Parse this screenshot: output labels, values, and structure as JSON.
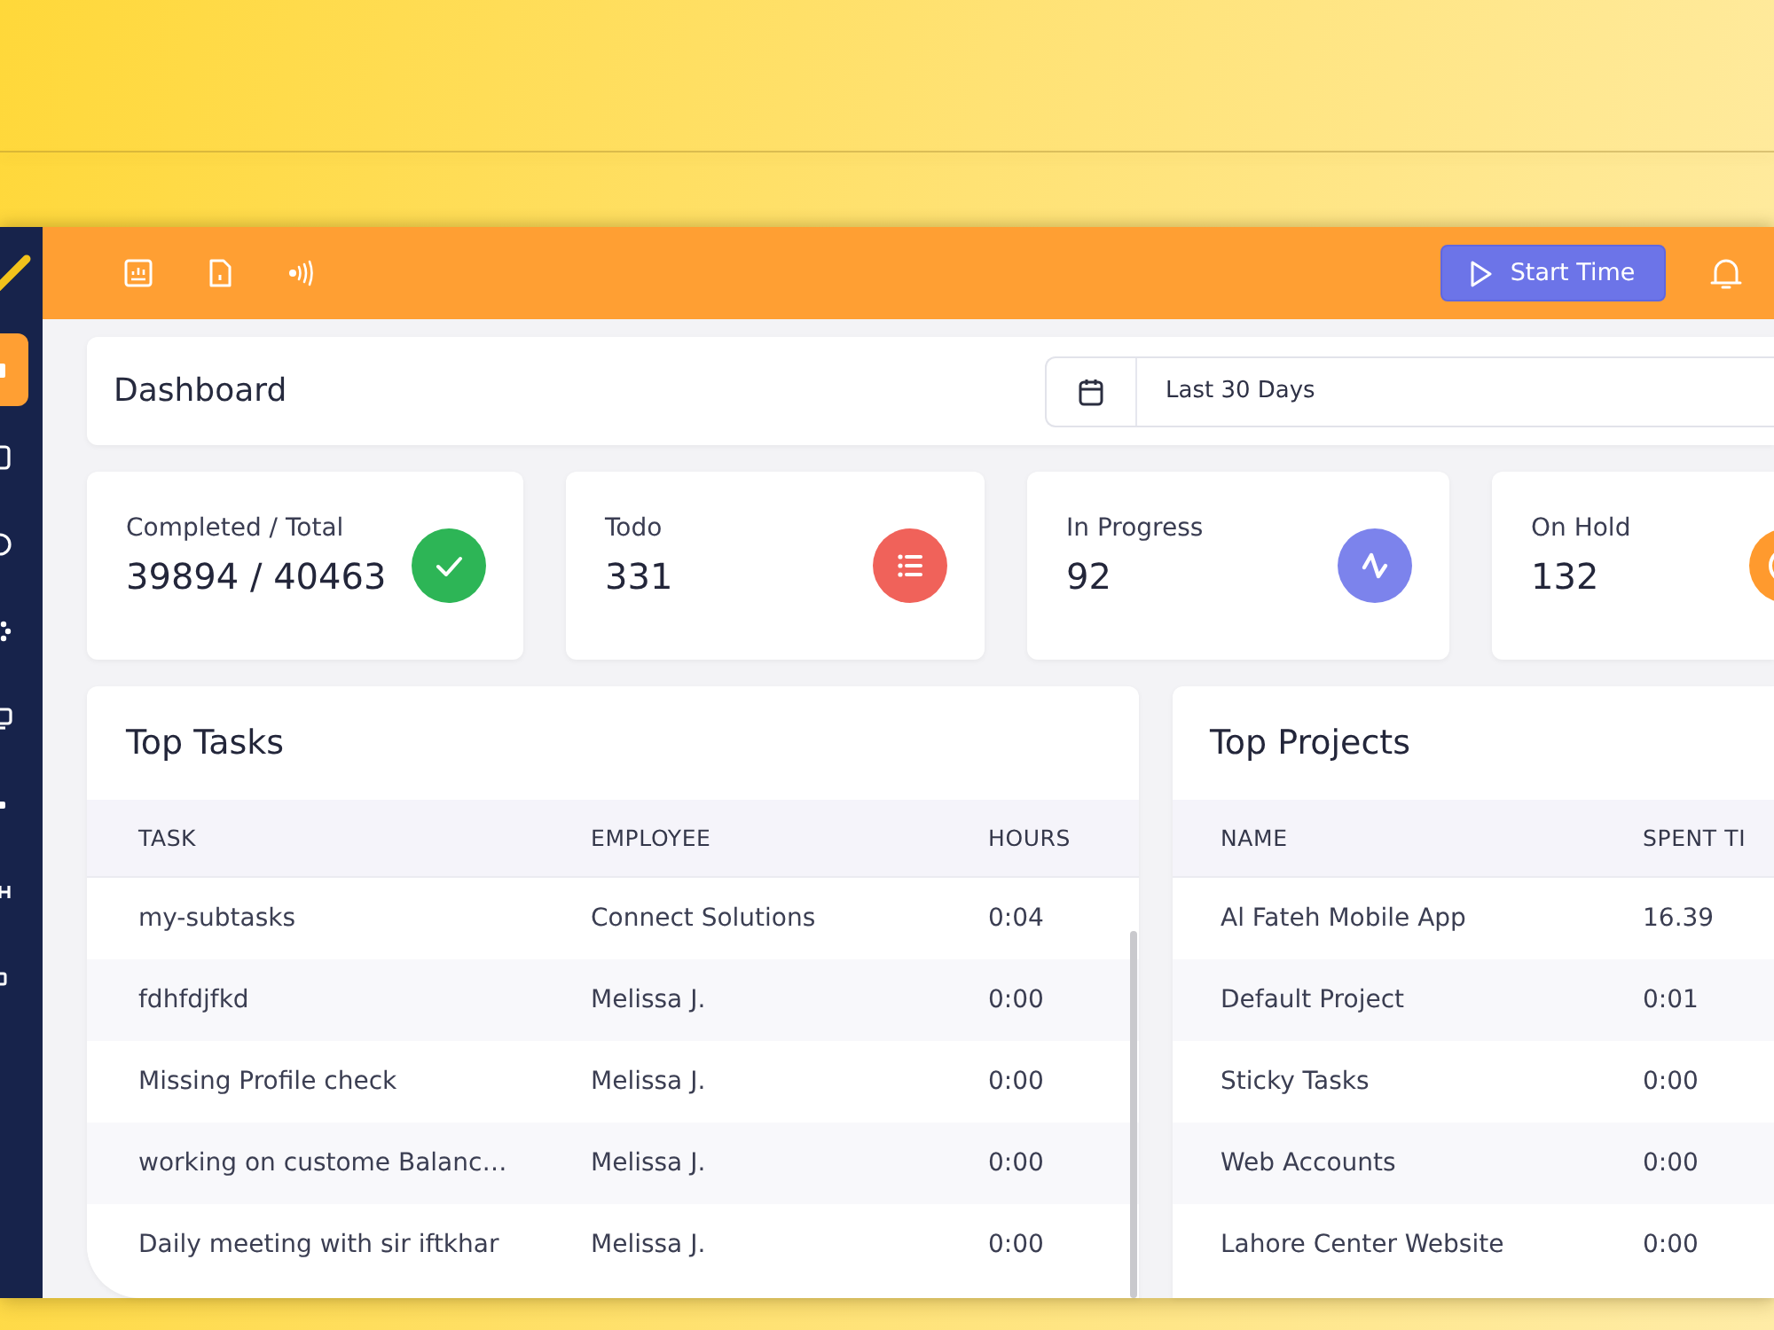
{
  "sidebar": {
    "items": [
      {
        "selected": true
      },
      {
        "selected": false
      },
      {
        "selected": false
      },
      {
        "selected": false
      },
      {
        "selected": false
      },
      {
        "selected": false
      },
      {
        "selected": false
      },
      {
        "selected": false
      }
    ]
  },
  "topbar": {
    "start_button": {
      "label": "Start Time"
    }
  },
  "header": {
    "title": "Dashboard",
    "date_range": {
      "value": "Last 30 Days"
    }
  },
  "stats": [
    {
      "label": "Completed / Total",
      "value": "39894 / 40463",
      "color": "#2db556"
    },
    {
      "label": "Todo",
      "value": "331",
      "color": "#f0625a"
    },
    {
      "label": "In Progress",
      "value": "92",
      "color": "#7c83ec"
    },
    {
      "label": "On Hold",
      "value": "132",
      "color": "#ff9a2e"
    }
  ],
  "top_tasks": {
    "title": "Top Tasks",
    "columns": [
      "TASK",
      "EMPLOYEE",
      "HOURS"
    ],
    "rows": [
      [
        "my-subtasks",
        "Connect Solutions",
        "0:04"
      ],
      [
        "fdhfdjfkd",
        "Melissa J.",
        "0:00"
      ],
      [
        "Missing Profile check",
        "Melissa J.",
        "0:00"
      ],
      [
        "working on custome Balanc…",
        "Melissa J.",
        "0:00"
      ],
      [
        "Daily meeting with sir iftkhar",
        "Melissa J.",
        "0:00"
      ]
    ]
  },
  "top_projects": {
    "title": "Top Projects",
    "columns": [
      "NAME",
      "SPENT TI"
    ],
    "rows": [
      [
        "Al Fateh Mobile App",
        "16.39"
      ],
      [
        "Default Project",
        "0:01"
      ],
      [
        "Sticky Tasks",
        "0:00"
      ],
      [
        "Web Accounts",
        "0:00"
      ],
      [
        "Lahore Center Website",
        "0:00"
      ]
    ]
  }
}
